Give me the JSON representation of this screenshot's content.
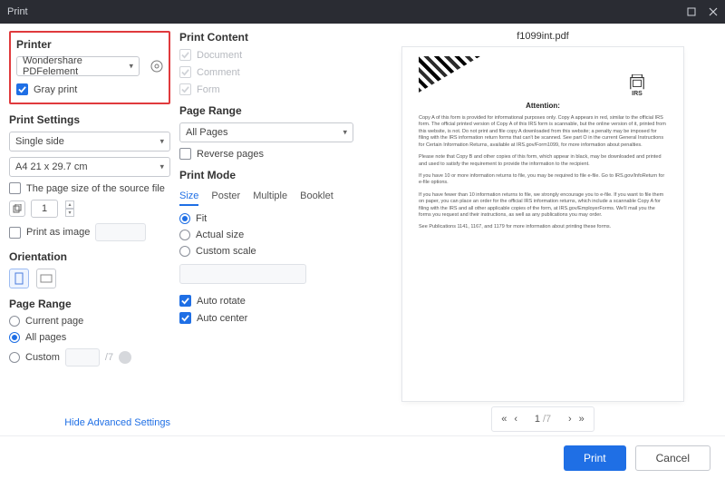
{
  "window": {
    "title": "Print"
  },
  "printer": {
    "section_label": "Printer",
    "selected": "Wondershare PDFelement",
    "gray_print_label": "Gray print",
    "gray_print_checked": true
  },
  "print_settings": {
    "section_label": "Print Settings",
    "sides": "Single side",
    "paper": "A4 21 x 29.7 cm",
    "source_size_label": "The page size of the source file",
    "copies_value": "1",
    "print_as_image_label": "Print as image"
  },
  "orientation": {
    "section_label": "Orientation"
  },
  "left_page_range": {
    "section_label": "Page Range",
    "current_page": "Current page",
    "all_pages": "All pages",
    "custom": "Custom",
    "range_total": "/7",
    "all_selected": true
  },
  "advanced_link": "Hide Advanced Settings",
  "content": {
    "section_label": "Print Content",
    "items": [
      "Document",
      "Comment",
      "Form"
    ]
  },
  "mid_page_range": {
    "section_label": "Page Range",
    "selected": "All Pages",
    "reverse": "Reverse pages"
  },
  "print_mode": {
    "section_label": "Print Mode",
    "tabs": [
      "Size",
      "Poster",
      "Multiple",
      "Booklet"
    ],
    "active_tab": "Size",
    "fit": "Fit",
    "actual": "Actual size",
    "custom": "Custom scale",
    "auto_rotate": "Auto rotate",
    "auto_center": "Auto center"
  },
  "preview": {
    "filename": "f1099int.pdf",
    "attention": "Attention:",
    "p1": "Copy A of this form is provided for informational purposes only. Copy A appears in red, similar to the official IRS form. The official printed version of Copy A of this IRS form is scannable, but the online version of it, printed from this website, is not. Do not print and file copy A downloaded from this website; a penalty may be imposed for filing with the IRS information return forms that can't be scanned. See part O in the current General Instructions for Certain Information Returns, available at IRS.gov/Form1099, for more information about penalties.",
    "p2": "Please note that Copy B and other copies of this form, which appear in black, may be downloaded and printed and used to satisfy the requirement to provide the information to the recipient.",
    "p3": "If you have 10 or more information returns to file, you may be required to file e-file. Go to IRS.gov/InfoReturn for e-file options.",
    "p4": "If you have fewer than 10 information returns to file, we strongly encourage you to e-file. If you want to file them on paper, you can place an order for the official IRS information returns, which include a scannable Copy A for filing with the IRS and all other applicable copies of the form, at IRS.gov/EmployerForms. We'll mail you the forms you request and their instructions, as well as any publications you may order.",
    "p5": "See Publications 1141, 1167, and 1179 for more information about printing these forms.",
    "irs_label": "IRS"
  },
  "pager": {
    "page": "1",
    "total": "/7"
  },
  "footer": {
    "print": "Print",
    "cancel": "Cancel"
  }
}
